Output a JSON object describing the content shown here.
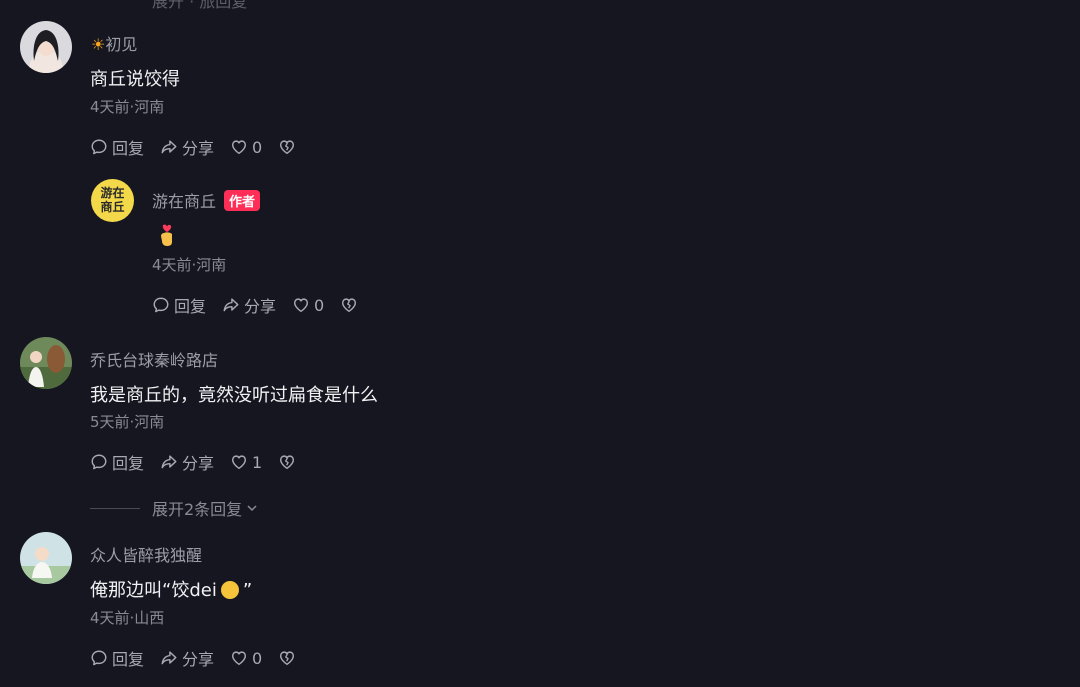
{
  "top_partial": {
    "text": "展开 · 旅回复"
  },
  "comments": [
    {
      "name": "初见",
      "text": "商丘说饺得",
      "meta": "4天前·河南",
      "actions": {
        "reply": "回复",
        "share": "分享",
        "likes": "0"
      },
      "reply": {
        "name": "游在商丘",
        "badge": "作者",
        "avatar_text": "游在商丘",
        "meta": "4天前·河南",
        "actions": {
          "reply": "回复",
          "share": "分享",
          "likes": "0"
        }
      }
    },
    {
      "name": "乔氏台球秦岭路店",
      "text": "我是商丘的，竟然没听过扁食是什么",
      "meta": "5天前·河南",
      "actions": {
        "reply": "回复",
        "share": "分享",
        "likes": "1"
      },
      "expand": "展开2条回复"
    },
    {
      "name": "众人皆醉我独醒",
      "text_before": "俺那边叫“饺dei",
      "text_after": "”",
      "meta": "4天前·山西",
      "actions": {
        "reply": "回复",
        "share": "分享",
        "likes": "0"
      }
    }
  ],
  "colors": {
    "background": "#161620",
    "badge": "#ff2e56"
  }
}
